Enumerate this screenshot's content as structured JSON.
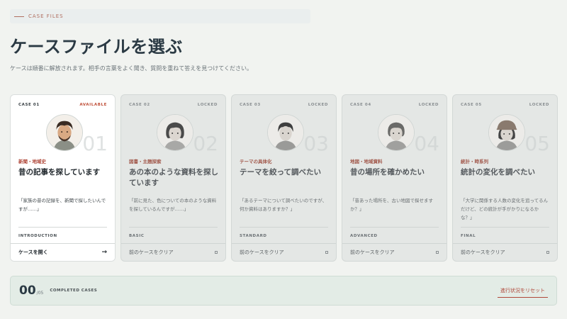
{
  "header": {
    "kicker": "CASE FILES",
    "title": "ケースファイルを選ぶ",
    "subtitle": "ケースは順番に解放されます。相手の言葉をよく聞き、質問を重ねて答えを見つけてください。"
  },
  "cards": [
    {
      "case_no": "CASE 01",
      "status": "AVAILABLE",
      "number": "01",
      "tag": "新聞・地域史",
      "title": "昔の記事を探しています",
      "quote": "「家族の昔の記録を、新聞で探したいんですが……」",
      "level": "INTRODUCTION",
      "action": "ケースを開く",
      "action_icon": "arrow-right-icon",
      "avatar": "man-curly-hair-beard"
    },
    {
      "case_no": "CASE 02",
      "status": "LOCKED",
      "number": "02",
      "tag": "図書・主題探索",
      "title": "あの本のような資料を探しています",
      "quote": "「前に見た、色についての本のような資料を探しているんですが……」",
      "level": "BASIC",
      "action": "前のケースをクリア",
      "action_icon": "lock-icon",
      "avatar": "woman-short-hair"
    },
    {
      "case_no": "CASE 03",
      "status": "LOCKED",
      "number": "03",
      "tag": "テーマの具体化",
      "title": "テーマを絞って調べたい",
      "quote": "「あるテーマについて調べたいのですが、何か資料はありますか？」",
      "level": "STANDARD",
      "action": "前のケースをクリア",
      "action_icon": "lock-icon",
      "avatar": "young-man"
    },
    {
      "case_no": "CASE 04",
      "status": "LOCKED",
      "number": "04",
      "tag": "地図・地域資料",
      "title": "昔の場所を確かめたい",
      "quote": "「昔あった場所を、古い地図で探せますか？」",
      "level": "ADVANCED",
      "action": "前のケースをクリア",
      "action_icon": "lock-icon",
      "avatar": "older-woman"
    },
    {
      "case_no": "CASE 05",
      "status": "LOCKED",
      "number": "05",
      "tag": "統計・時系列",
      "title": "統計の変化を調べたい",
      "quote": "「大学に関係する人数の変化を追ってるんだけど、どの統計が手がかりになるかな？」",
      "level": "FINAL",
      "action": "前のケースをクリア",
      "action_icon": "lock-icon",
      "avatar": "woman-with-cap"
    }
  ],
  "progress": {
    "completed": "00",
    "total": "/05",
    "label": "COMPLETED CASES",
    "reset": "進行状況をリセット"
  },
  "colors": {
    "accent": "#b0483a",
    "background": "#f1f3f0",
    "locked_card": "#e4e7e5"
  }
}
